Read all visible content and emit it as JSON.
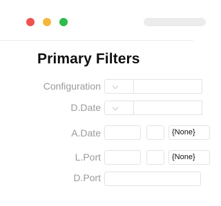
{
  "window": {
    "controls": [
      "close",
      "minimize",
      "maximize"
    ],
    "colors": {
      "close": "#f0524f",
      "minimize": "#f3b73c",
      "maximize": "#2dbb4b"
    }
  },
  "panel": {
    "title": "Primary Filters",
    "fields": {
      "configuration": {
        "label": "Configuration",
        "value": ""
      },
      "d_date": {
        "label": "D.Date",
        "value": ""
      },
      "a_date": {
        "label": "A.Date",
        "value": "",
        "secondary": "",
        "select_value": "{None}"
      },
      "l_port": {
        "label": "L.Port",
        "value": "",
        "secondary": "",
        "select_value": "{None}"
      },
      "d_port": {
        "label": "D.Port",
        "value": ""
      }
    }
  }
}
